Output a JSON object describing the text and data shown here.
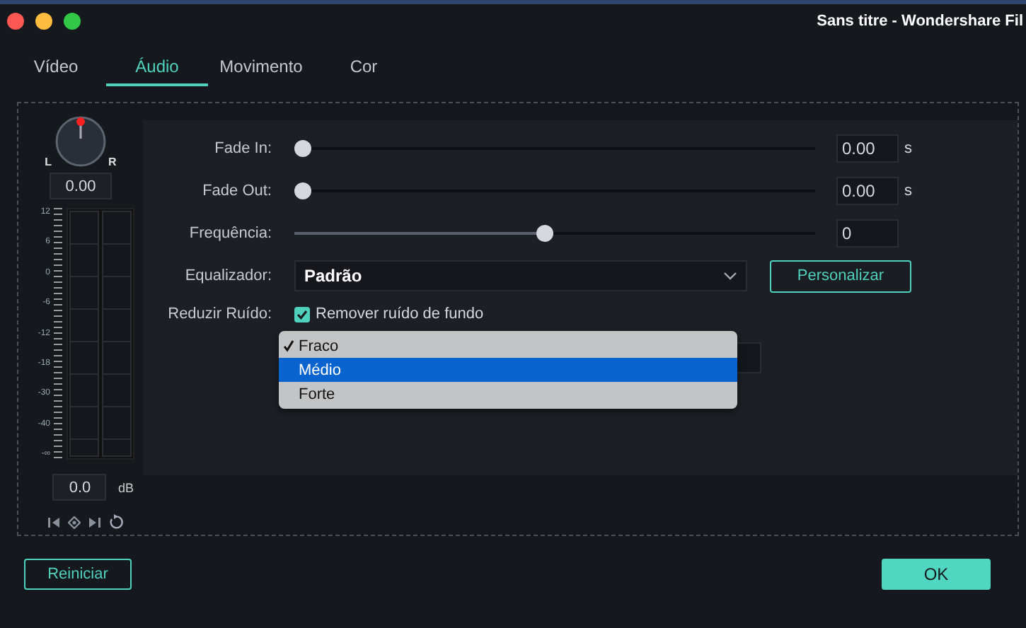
{
  "window": {
    "title": "Sans titre - Wondershare Fil"
  },
  "tabs": [
    {
      "label": "Vídeo",
      "selected": false
    },
    {
      "label": "Áudio",
      "selected": true
    },
    {
      "label": "Movimento",
      "selected": false
    },
    {
      "label": "Cor",
      "selected": false
    }
  ],
  "pan": {
    "left_label": "L",
    "right_label": "R",
    "value": "0.00"
  },
  "meter": {
    "scale": [
      "12",
      "6",
      "0",
      "-6",
      "-12",
      "-18",
      "-30",
      "-40",
      "-∞"
    ],
    "value": "0.0",
    "unit": "dB"
  },
  "sliders": [
    {
      "label": "Fade In:",
      "level": 0,
      "value": "0.00",
      "unit": "s"
    },
    {
      "label": "Fade Out:",
      "level": 0,
      "value": "0.00",
      "unit": "s"
    },
    {
      "label": "Frequência:",
      "level": 0.48,
      "value": "0"
    }
  ],
  "equalizer": {
    "label": "Equalizador:",
    "value": "Padrão",
    "button": "Personalizar"
  },
  "noise": {
    "label": "Reduzir Ruído:",
    "checkbox_label": "Remover ruído de fundo",
    "checked": true,
    "menu": [
      {
        "label": "Fraco",
        "checked": true,
        "selected": false
      },
      {
        "label": "Médio",
        "checked": false,
        "selected": true
      },
      {
        "label": "Forte",
        "checked": false,
        "selected": false
      }
    ]
  },
  "buttons": {
    "reset": "Reiniciar",
    "ok": "OK"
  }
}
